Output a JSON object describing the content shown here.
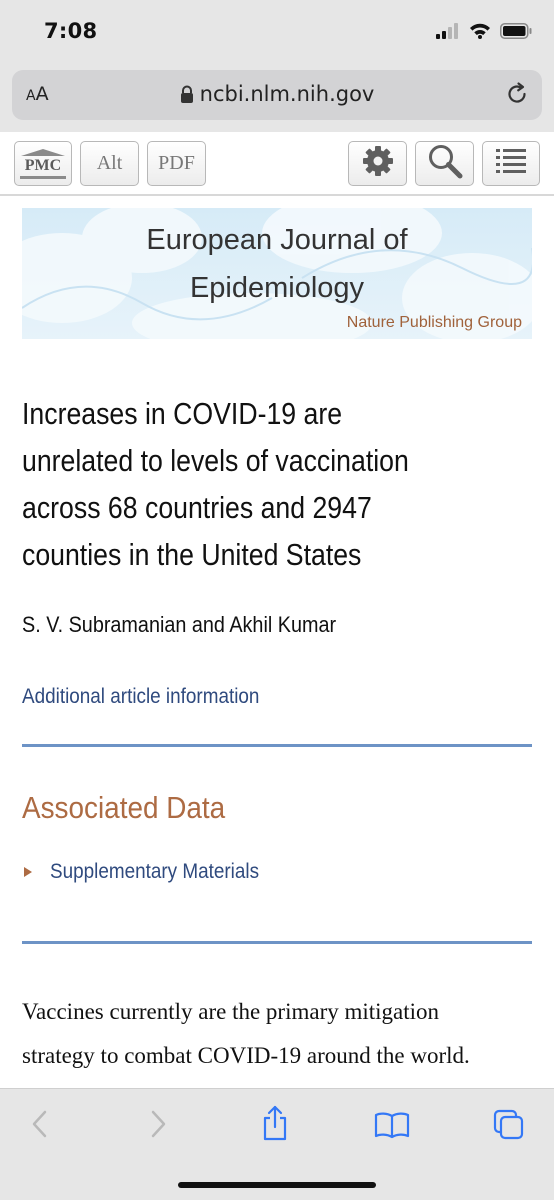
{
  "status_bar": {
    "time": "7:08"
  },
  "browser": {
    "aa_small": "A",
    "aa_large": "A",
    "url": "ncbi.nlm.nih.gov"
  },
  "toolbar": {
    "pmc_label": "PMC",
    "alt_label": "Alt",
    "pdf_label": "PDF"
  },
  "banner": {
    "journal_title_line1": "European Journal of",
    "journal_title_line2": "Epidemiology",
    "publisher": "Nature Publishing Group"
  },
  "article": {
    "title_lines": [
      "Increases in COVID-19 are",
      "unrelated to levels of vaccination",
      "across 68 countries and 2947",
      "counties in the United States"
    ],
    "authors": "S. V. Subramanian and Akhil Kumar",
    "additional_info_link": "Additional article information",
    "associated_data_heading": "Associated Data",
    "supplementary_link": "Supplementary Materials",
    "body_lines": [
      "Vaccines currently are the primary mitigation",
      "strategy to combat COVID-19 around the world."
    ]
  },
  "colors": {
    "link": "#2f4a7e",
    "accent_brown": "#ad6b43",
    "divider_blue": "#6d93c6",
    "ios_blue": "#3478f6"
  },
  "icons": {
    "status": [
      "cellular-signal-icon",
      "wifi-icon",
      "battery-icon"
    ],
    "address_bar": [
      "lock-icon",
      "reload-icon"
    ],
    "pmc_tools": [
      "gear-icon",
      "search-icon",
      "list-icon"
    ],
    "bottom_nav": [
      "back-icon",
      "forward-icon",
      "share-icon",
      "bookmarks-icon",
      "tabs-icon"
    ]
  }
}
